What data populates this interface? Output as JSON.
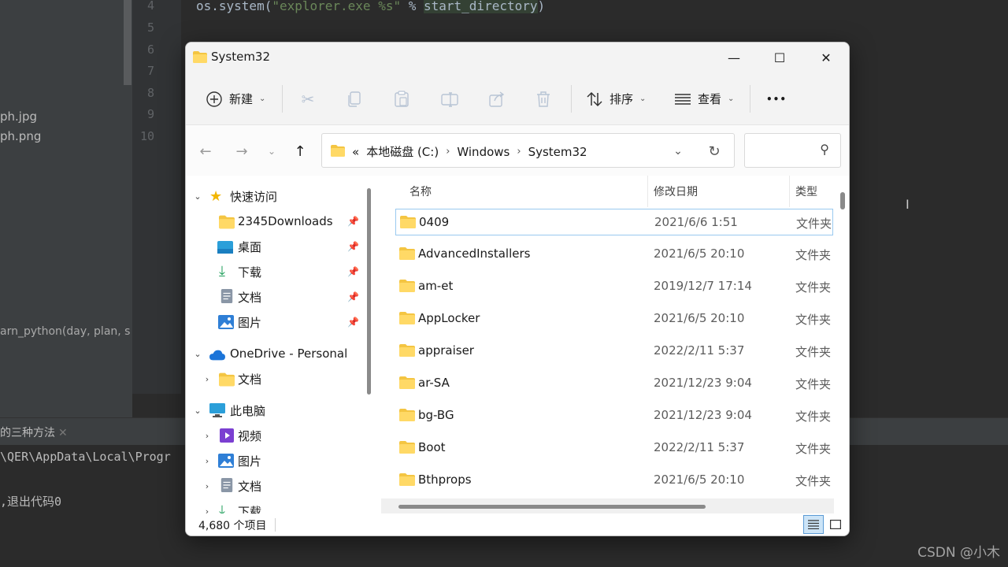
{
  "ide": {
    "code_prefix": "os.system(",
    "code_string": "\"explorer.exe %s\"",
    "code_op": " % ",
    "code_var": "start_directory",
    "code_suffix": ")",
    "line_numbers": [
      "4",
      "5",
      "6",
      "7",
      "8",
      "9",
      "10"
    ],
    "project_files": [
      "ph.jpg",
      "ph.png"
    ],
    "structure_item": "arn_python(day, plan, s",
    "run_tab": "的三种方法",
    "console_lines": [
      "\\QER\\AppData\\Local\\Progr",
      ",退出代码0"
    ],
    "watermark": "CSDN @小木"
  },
  "window": {
    "title": "System32",
    "controls": {
      "minimize": "—",
      "maximize": "☐",
      "close": "✕"
    }
  },
  "toolbar": {
    "new_label": "新建",
    "sort_label": "排序",
    "view_label": "查看",
    "more_label": "•••"
  },
  "address": {
    "overflow": "«",
    "crumbs": [
      "本地磁盘 (C:)",
      "Windows",
      "System32"
    ]
  },
  "nav": {
    "quick_access": "快速访问",
    "quick_items": [
      "2345Downloads",
      "桌面",
      "下载",
      "文档",
      "图片"
    ],
    "onedrive": "OneDrive - Personal",
    "onedrive_items": [
      "文档"
    ],
    "this_pc": "此电脑",
    "pc_items": [
      "视频",
      "图片",
      "文档",
      "下载"
    ]
  },
  "columns": {
    "name": "名称",
    "date": "修改日期",
    "type": "类型"
  },
  "files": [
    {
      "name": "0409",
      "date": "2021/6/6 1:51",
      "type": "文件夹"
    },
    {
      "name": "AdvancedInstallers",
      "date": "2021/6/5 20:10",
      "type": "文件夹"
    },
    {
      "name": "am-et",
      "date": "2019/12/7 17:14",
      "type": "文件夹"
    },
    {
      "name": "AppLocker",
      "date": "2021/6/5 20:10",
      "type": "文件夹"
    },
    {
      "name": "appraiser",
      "date": "2022/2/11 5:37",
      "type": "文件夹"
    },
    {
      "name": "ar-SA",
      "date": "2021/12/23 9:04",
      "type": "文件夹"
    },
    {
      "name": "bg-BG",
      "date": "2021/12/23 9:04",
      "type": "文件夹"
    },
    {
      "name": "Boot",
      "date": "2022/2/11 5:37",
      "type": "文件夹"
    },
    {
      "name": "Bthprops",
      "date": "2021/6/5 20:10",
      "type": "文件夹"
    }
  ],
  "status": {
    "count": "4,680 个项目"
  },
  "colors": {
    "folder": "#f4c542",
    "accent": "#0067c0",
    "selection_border": "#99c9ef"
  }
}
